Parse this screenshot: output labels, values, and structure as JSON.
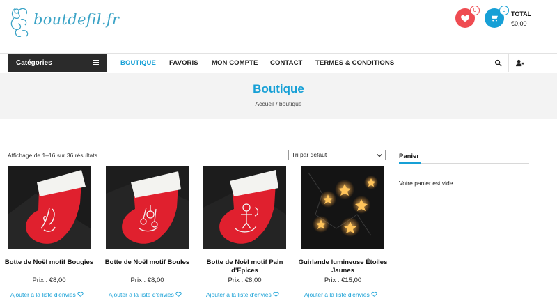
{
  "header": {
    "logo_text": "boutdefil.fr",
    "wishlist_count": "0",
    "cart_count": "0",
    "total_label": "TOTAL",
    "total_amount": "€0,00"
  },
  "nav": {
    "categories_label": "Catégories",
    "items": [
      "BOUTIQUE",
      "FAVORIS",
      "MON COMPTE",
      "CONTACT",
      "TERMES & CONDITIONS"
    ],
    "active_item": "BOUTIQUE"
  },
  "banner": {
    "title": "Boutique",
    "breadcrumb": "Accueil / boutique"
  },
  "shop": {
    "result_count": "Affichage de 1–16 sur 36 résultats",
    "sort_selected": "Tri par défaut"
  },
  "products": [
    {
      "name": "Botte de Noël motif Bougies",
      "price": "Prix : €8,00",
      "wishlist_link": "Ajouter à la liste d'envies"
    },
    {
      "name": "Botte de Noël motif Boules",
      "price": "Prix : €8,00",
      "wishlist_link": "Ajouter à la liste d'envies"
    },
    {
      "name": "Botte de Noël motif Pain d'Epices",
      "price": "Prix : €8,00",
      "wishlist_link": "Ajouter à la liste d'envies"
    },
    {
      "name": "Guirlande lumineuse Étoiles Jaunes",
      "price": "Prix : €15,00",
      "wishlist_link": "Ajouter à la liste d'envies"
    }
  ],
  "sidebar": {
    "cart_title": "Panier",
    "cart_empty": "Votre panier est vide."
  },
  "colors": {
    "accent": "#17a0d6",
    "wishlist": "#ef4c52",
    "dark": "#2b2b2b",
    "stocking_red": "#e0202e"
  },
  "icons": [
    "logo-illustration",
    "heart-icon",
    "cart-icon",
    "menu-icon",
    "search-icon",
    "user-icon",
    "heart-outline-icon",
    "chevron-down-icon"
  ]
}
